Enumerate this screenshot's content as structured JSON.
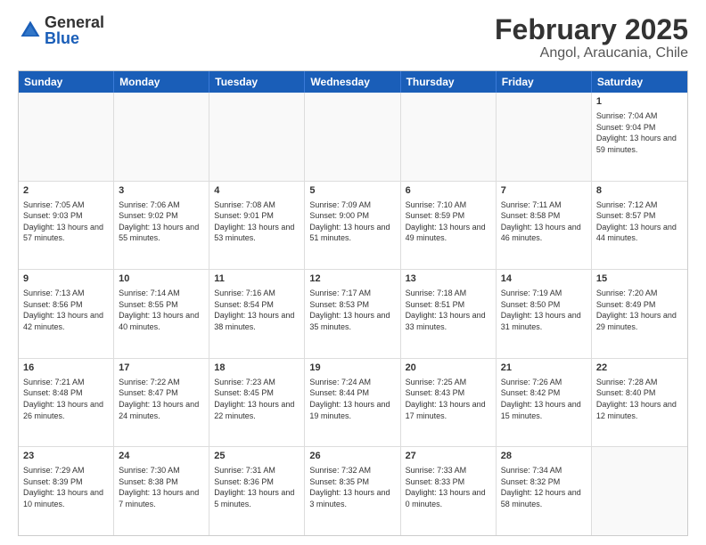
{
  "header": {
    "logo": {
      "general": "General",
      "blue": "Blue"
    },
    "title": "February 2025",
    "subtitle": "Angol, Araucania, Chile"
  },
  "calendar": {
    "days_of_week": [
      "Sunday",
      "Monday",
      "Tuesday",
      "Wednesday",
      "Thursday",
      "Friday",
      "Saturday"
    ],
    "weeks": [
      [
        {
          "day": "",
          "info": "",
          "empty": true
        },
        {
          "day": "",
          "info": "",
          "empty": true
        },
        {
          "day": "",
          "info": "",
          "empty": true
        },
        {
          "day": "",
          "info": "",
          "empty": true
        },
        {
          "day": "",
          "info": "",
          "empty": true
        },
        {
          "day": "",
          "info": "",
          "empty": true
        },
        {
          "day": "1",
          "info": "Sunrise: 7:04 AM\nSunset: 9:04 PM\nDaylight: 13 hours\nand 59 minutes."
        }
      ],
      [
        {
          "day": "2",
          "info": "Sunrise: 7:05 AM\nSunset: 9:03 PM\nDaylight: 13 hours\nand 57 minutes."
        },
        {
          "day": "3",
          "info": "Sunrise: 7:06 AM\nSunset: 9:02 PM\nDaylight: 13 hours\nand 55 minutes."
        },
        {
          "day": "4",
          "info": "Sunrise: 7:08 AM\nSunset: 9:01 PM\nDaylight: 13 hours\nand 53 minutes."
        },
        {
          "day": "5",
          "info": "Sunrise: 7:09 AM\nSunset: 9:00 PM\nDaylight: 13 hours\nand 51 minutes."
        },
        {
          "day": "6",
          "info": "Sunrise: 7:10 AM\nSunset: 8:59 PM\nDaylight: 13 hours\nand 49 minutes."
        },
        {
          "day": "7",
          "info": "Sunrise: 7:11 AM\nSunset: 8:58 PM\nDaylight: 13 hours\nand 46 minutes."
        },
        {
          "day": "8",
          "info": "Sunrise: 7:12 AM\nSunset: 8:57 PM\nDaylight: 13 hours\nand 44 minutes."
        }
      ],
      [
        {
          "day": "9",
          "info": "Sunrise: 7:13 AM\nSunset: 8:56 PM\nDaylight: 13 hours\nand 42 minutes."
        },
        {
          "day": "10",
          "info": "Sunrise: 7:14 AM\nSunset: 8:55 PM\nDaylight: 13 hours\nand 40 minutes."
        },
        {
          "day": "11",
          "info": "Sunrise: 7:16 AM\nSunset: 8:54 PM\nDaylight: 13 hours\nand 38 minutes."
        },
        {
          "day": "12",
          "info": "Sunrise: 7:17 AM\nSunset: 8:53 PM\nDaylight: 13 hours\nand 35 minutes."
        },
        {
          "day": "13",
          "info": "Sunrise: 7:18 AM\nSunset: 8:51 PM\nDaylight: 13 hours\nand 33 minutes."
        },
        {
          "day": "14",
          "info": "Sunrise: 7:19 AM\nSunset: 8:50 PM\nDaylight: 13 hours\nand 31 minutes."
        },
        {
          "day": "15",
          "info": "Sunrise: 7:20 AM\nSunset: 8:49 PM\nDaylight: 13 hours\nand 29 minutes."
        }
      ],
      [
        {
          "day": "16",
          "info": "Sunrise: 7:21 AM\nSunset: 8:48 PM\nDaylight: 13 hours\nand 26 minutes."
        },
        {
          "day": "17",
          "info": "Sunrise: 7:22 AM\nSunset: 8:47 PM\nDaylight: 13 hours\nand 24 minutes."
        },
        {
          "day": "18",
          "info": "Sunrise: 7:23 AM\nSunset: 8:45 PM\nDaylight: 13 hours\nand 22 minutes."
        },
        {
          "day": "19",
          "info": "Sunrise: 7:24 AM\nSunset: 8:44 PM\nDaylight: 13 hours\nand 19 minutes."
        },
        {
          "day": "20",
          "info": "Sunrise: 7:25 AM\nSunset: 8:43 PM\nDaylight: 13 hours\nand 17 minutes."
        },
        {
          "day": "21",
          "info": "Sunrise: 7:26 AM\nSunset: 8:42 PM\nDaylight: 13 hours\nand 15 minutes."
        },
        {
          "day": "22",
          "info": "Sunrise: 7:28 AM\nSunset: 8:40 PM\nDaylight: 13 hours\nand 12 minutes."
        }
      ],
      [
        {
          "day": "23",
          "info": "Sunrise: 7:29 AM\nSunset: 8:39 PM\nDaylight: 13 hours\nand 10 minutes."
        },
        {
          "day": "24",
          "info": "Sunrise: 7:30 AM\nSunset: 8:38 PM\nDaylight: 13 hours\nand 7 minutes."
        },
        {
          "day": "25",
          "info": "Sunrise: 7:31 AM\nSunset: 8:36 PM\nDaylight: 13 hours\nand 5 minutes."
        },
        {
          "day": "26",
          "info": "Sunrise: 7:32 AM\nSunset: 8:35 PM\nDaylight: 13 hours\nand 3 minutes."
        },
        {
          "day": "27",
          "info": "Sunrise: 7:33 AM\nSunset: 8:33 PM\nDaylight: 13 hours\nand 0 minutes."
        },
        {
          "day": "28",
          "info": "Sunrise: 7:34 AM\nSunset: 8:32 PM\nDaylight: 12 hours\nand 58 minutes."
        },
        {
          "day": "",
          "info": "",
          "empty": true
        }
      ]
    ]
  }
}
